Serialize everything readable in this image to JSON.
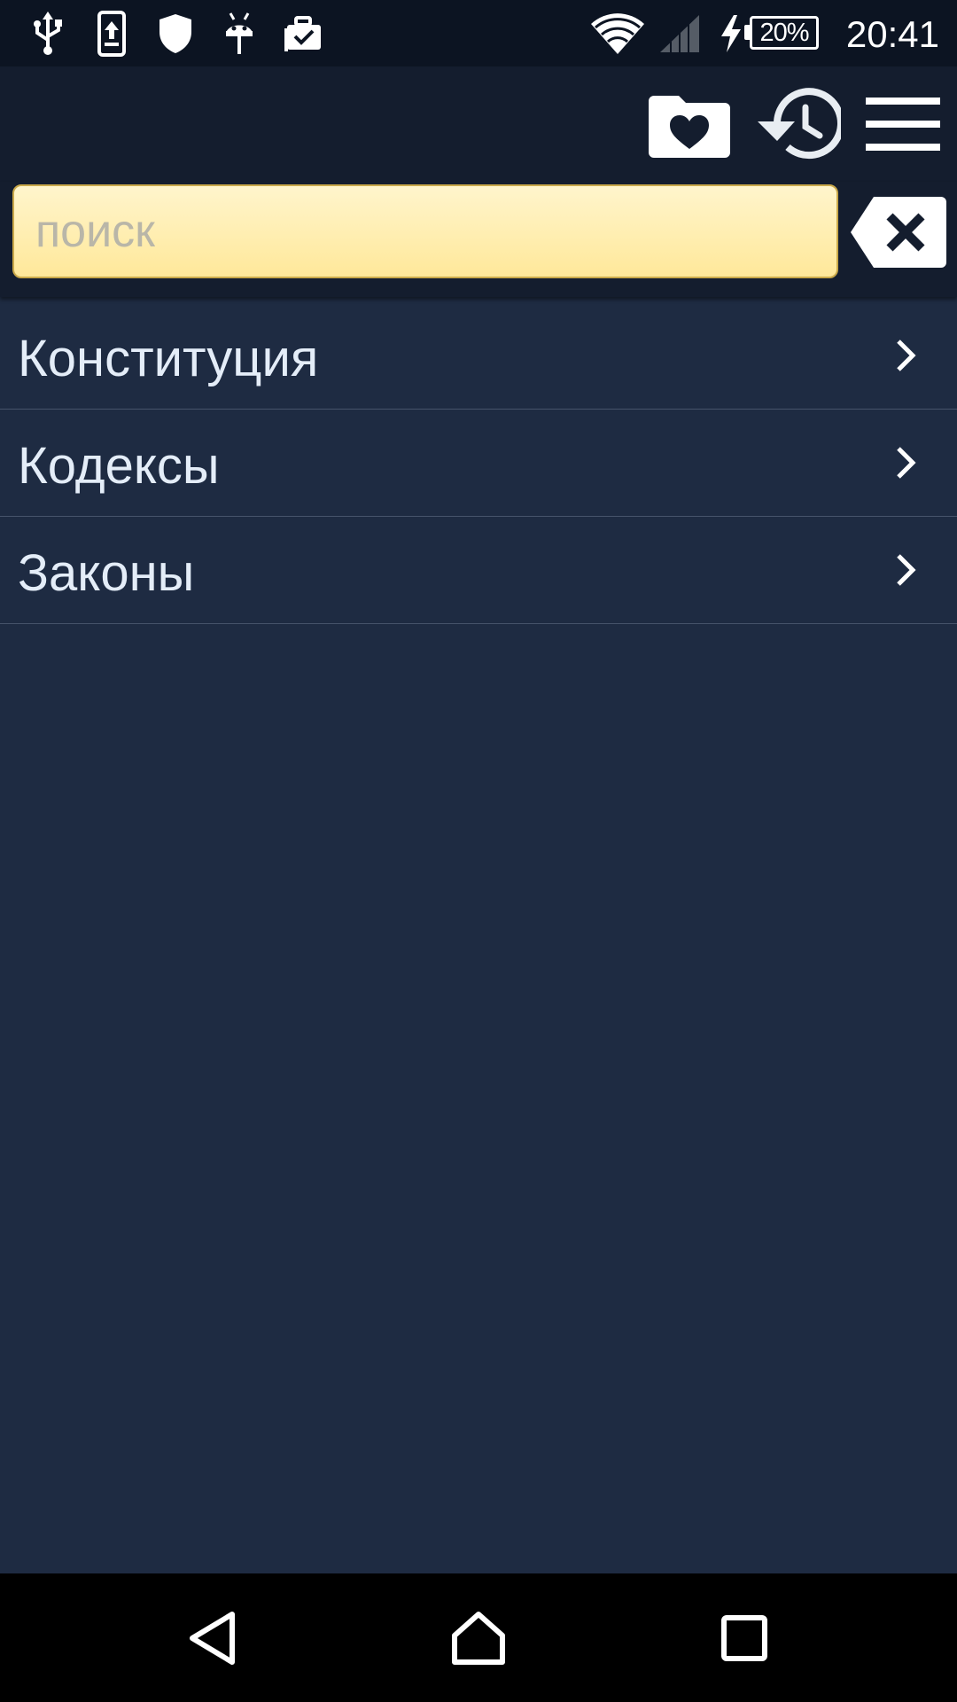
{
  "status_bar": {
    "battery_text": "20%",
    "time": "20:41",
    "left_icons": [
      "usb-icon",
      "phone-upload-icon",
      "shield-icon",
      "android-icon",
      "briefcase-check-icon"
    ],
    "right_icons": [
      "wifi-icon",
      "cell-signal-icon",
      "charging-bolt-icon",
      "battery-icon"
    ]
  },
  "toolbar": {
    "icons": [
      "favorites-folder-icon",
      "history-icon",
      "menu-icon"
    ]
  },
  "search": {
    "placeholder": "поиск",
    "value": ""
  },
  "list": {
    "items": [
      {
        "label": "Конституция"
      },
      {
        "label": "Кодексы"
      },
      {
        "label": "Законы"
      }
    ]
  },
  "nav_bar": {
    "icons": [
      "back-icon",
      "home-icon",
      "recents-icon"
    ]
  },
  "colors": {
    "background": "#1e2b42",
    "toolbar": "#141d2e",
    "status_bar": "#0c1422",
    "search_field": "#ffe89a",
    "list_text": "#e4edf8"
  }
}
